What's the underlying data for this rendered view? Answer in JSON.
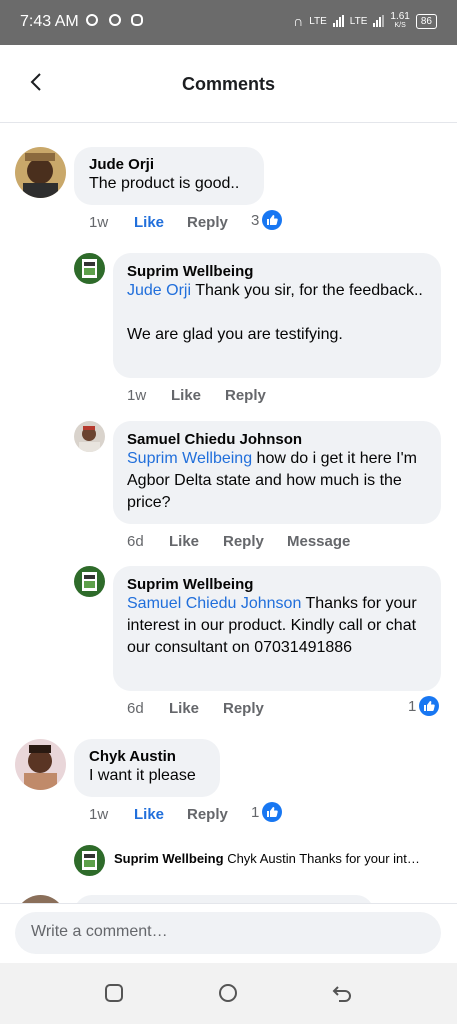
{
  "status_bar": {
    "time": "7:43 AM",
    "net1": "LTE",
    "net2": "LTE",
    "speed": "1.61",
    "speed_unit": "K/S",
    "battery": "86"
  },
  "header": {
    "title": "Comments"
  },
  "comments": [
    {
      "author": "Jude Orji",
      "text": "The product is good..",
      "time": "1w",
      "like": "Like",
      "reply": "Reply",
      "reactions": "3",
      "replies": [
        {
          "author": "Suprim Wellbeing",
          "mention": "Jude Orji",
          "text": " Thank you sir, for the feedback..\n\nWe are glad you are testifying.",
          "time": "1w",
          "like": "Like",
          "reply": "Reply"
        },
        {
          "author": "Samuel Chiedu Johnson",
          "mention": "Suprim Wellbeing",
          "text": "  how do i get it here I'm Agbor Delta state and how much is the price?",
          "time": "6d",
          "like": "Like",
          "reply": "Reply",
          "message": "Message"
        },
        {
          "author": "Suprim Wellbeing",
          "mention": "Samuel Chiedu Johnson",
          "text": " Thanks for your interest in our product. Kindly call or chat our consultant on 07031491886",
          "time": "6d",
          "like": "Like",
          "reply": "Reply",
          "reactions": "1"
        }
      ]
    },
    {
      "author": "Chyk Austin",
      "text": "I want it please",
      "time": "1w",
      "like": "Like",
      "reply": "Reply",
      "reactions": "1",
      "reply_preview": {
        "author": "Suprim Wellbeing",
        "text": "Chyk Austin Thanks for your int…"
      }
    }
  ],
  "composer": {
    "placeholder": "Write a comment…"
  },
  "colors": {
    "link": "#216fdb",
    "bubble": "#f0f2f5",
    "meta": "#65676b",
    "like_badge": "#1877f2"
  },
  "icons": [
    "back-arrow-icon",
    "thumbs-up-icon",
    "recent-apps-icon",
    "home-icon",
    "back-icon"
  ]
}
